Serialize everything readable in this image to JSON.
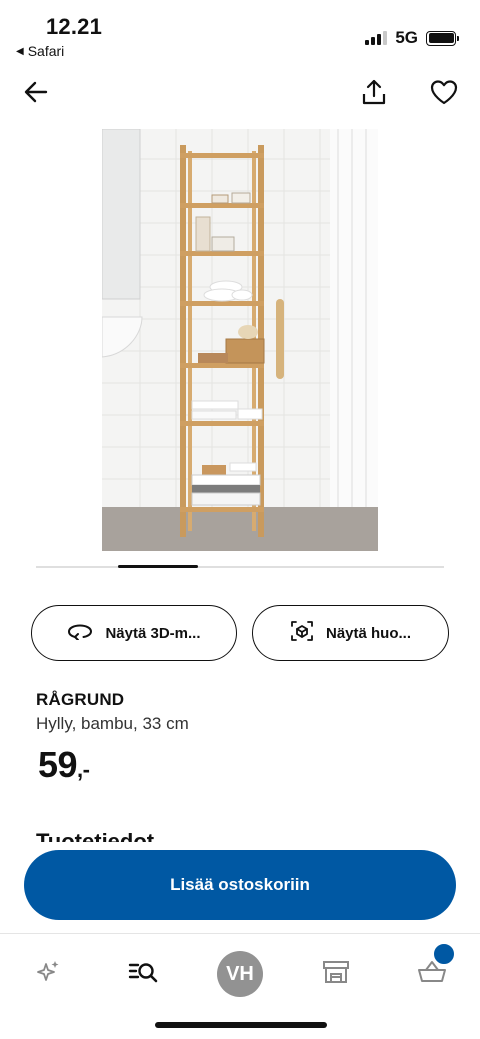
{
  "status_bar": {
    "time": "12.21",
    "back_app": "Safari",
    "network": "5G"
  },
  "nav": {
    "back_icon": "arrow-left-icon",
    "share_icon": "share-icon",
    "favorite_icon": "heart-icon"
  },
  "gallery": {
    "image_subject": "bamboo shelf unit",
    "image_count_indicator": "carousel"
  },
  "actions": {
    "view_3d_label": "Näytä 3D-m...",
    "view_in_room_label": "Näytä huo..."
  },
  "product": {
    "name": "RÅGRUND",
    "description": "Hylly, bambu, 33 cm",
    "price_main": "59",
    "price_suffix": ",-",
    "next_section_title": "Tuotetiedot"
  },
  "cart": {
    "add_label": "Lisää ostoskoriin"
  },
  "tabbar": {
    "discover_icon": "sparkle-icon",
    "search_icon": "search-list-icon",
    "profile_initials": "VH",
    "stores_icon": "store-icon",
    "cart_icon": "basket-icon"
  },
  "colors": {
    "brand_blue": "#0058a3",
    "avatar_gray": "#929292"
  }
}
